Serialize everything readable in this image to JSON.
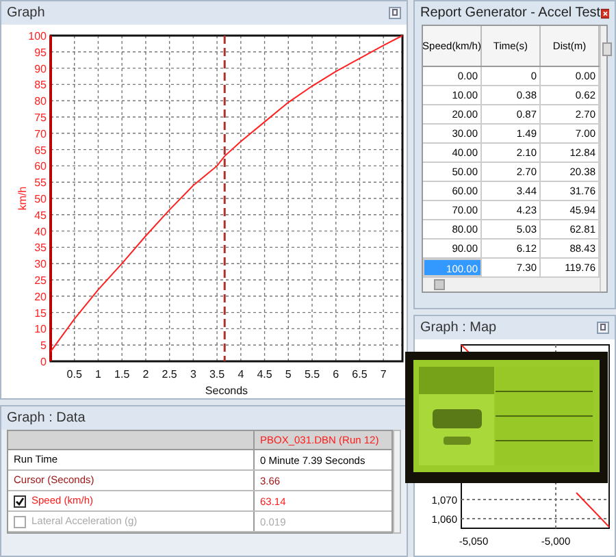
{
  "graph": {
    "title": "Graph",
    "chart_data": {
      "type": "line",
      "xlabel": "Seconds",
      "ylabel": "km/h",
      "xlim": [
        0,
        7.4
      ],
      "ylim": [
        0,
        100
      ],
      "xticks": [
        0.5,
        1,
        1.5,
        2,
        2.5,
        3,
        3.5,
        4,
        4.5,
        5,
        5.5,
        6,
        6.5,
        7
      ],
      "yticks": [
        0,
        5,
        10,
        15,
        20,
        25,
        30,
        35,
        40,
        45,
        50,
        55,
        60,
        65,
        70,
        75,
        80,
        85,
        90,
        95,
        100
      ],
      "x": [
        0,
        0.5,
        1,
        1.5,
        2,
        2.5,
        3,
        3.5,
        3.66,
        4,
        4.5,
        5,
        5.5,
        6,
        6.5,
        7,
        7.4
      ],
      "grid": true,
      "series": [
        {
          "color": "#ff2020",
          "values": [
            3,
            13,
            22,
            30,
            38.5,
            46.5,
            54,
            60,
            63,
            67.5,
            73.5,
            79.5,
            84.5,
            89,
            93,
            97,
            100
          ]
        }
      ],
      "ref_lines": [
        {
          "axis": "x",
          "value": 3.66,
          "color": "#b03030"
        }
      ]
    }
  },
  "report": {
    "title": "Report Generator - Accel Test",
    "columns": [
      "Speed(km/h)",
      "Time(s)",
      "Dist(m)"
    ],
    "rows": [
      {
        "cells": [
          "0.00",
          "0",
          "0.00"
        ],
        "selected": false
      },
      {
        "cells": [
          "10.00",
          "0.38",
          "0.62"
        ],
        "selected": false
      },
      {
        "cells": [
          "20.00",
          "0.87",
          "2.70"
        ],
        "selected": false
      },
      {
        "cells": [
          "30.00",
          "1.49",
          "7.00"
        ],
        "selected": false
      },
      {
        "cells": [
          "40.00",
          "2.10",
          "12.84"
        ],
        "selected": false
      },
      {
        "cells": [
          "50.00",
          "2.70",
          "20.38"
        ],
        "selected": false
      },
      {
        "cells": [
          "60.00",
          "3.44",
          "31.76"
        ],
        "selected": false
      },
      {
        "cells": [
          "70.00",
          "4.23",
          "45.94"
        ],
        "selected": false
      },
      {
        "cells": [
          "80.00",
          "5.03",
          "62.81"
        ],
        "selected": false
      },
      {
        "cells": [
          "90.00",
          "6.12",
          "88.43"
        ],
        "selected": false
      },
      {
        "cells": [
          "100.00",
          "7.30",
          "119.76"
        ],
        "selected": true
      }
    ]
  },
  "map": {
    "title": "Graph : Map",
    "y_labels": [
      "1,070",
      "1,060"
    ],
    "x_labels": [
      "-5,050",
      "-5,000"
    ]
  },
  "data": {
    "title": "Graph : Data",
    "header": "PBOX_031.DBN (Run 12)",
    "rows": [
      {
        "kind": "plain",
        "label": "Run Time",
        "value": "0 Minute 7.39 Seconds"
      },
      {
        "kind": "cursor",
        "label": "Cursor (Seconds)",
        "value": "3.66"
      },
      {
        "kind": "channel",
        "label": "Speed (km/h)",
        "value": "63.14",
        "checked": true
      },
      {
        "kind": "channel",
        "label": "Lateral Acceleration (g)",
        "value": "0.019",
        "checked": false
      }
    ]
  }
}
